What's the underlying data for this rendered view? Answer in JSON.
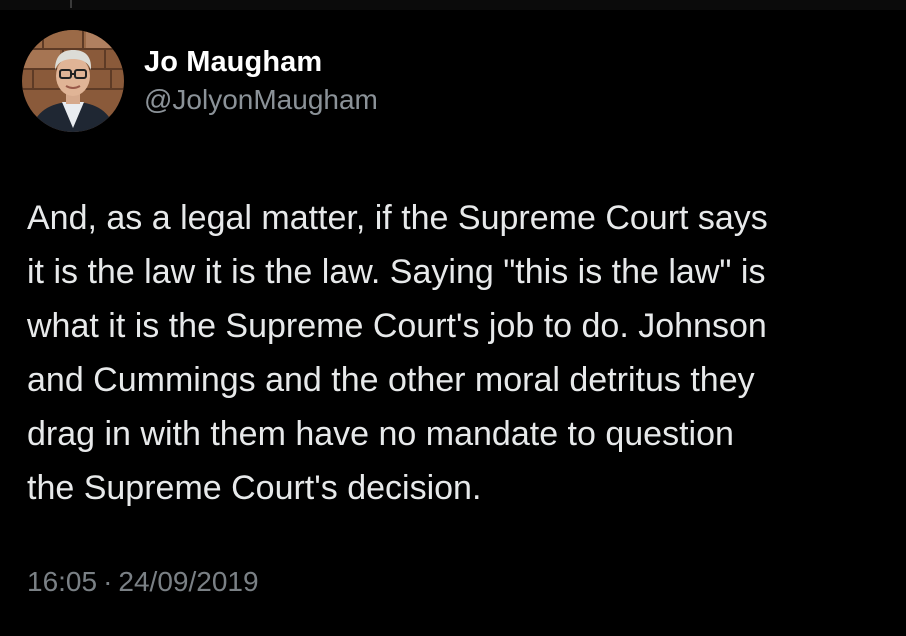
{
  "author": {
    "display_name": "Jo Maugham",
    "handle": "@JolyonMaugham",
    "avatar": "profile-photo"
  },
  "tweet": {
    "text": "And, as a legal matter, if the Supreme Court says\nit is the law it is the law. Saying \"this is the law\" is\nwhat it is the Supreme Court's job to do. Johnson\nand Cummings and the other moral detritus they\ndrag in with them have no mandate to question\nthe Supreme Court's decision."
  },
  "meta": {
    "time": "16:05",
    "separator": "·",
    "date": "24/09/2019"
  },
  "colors": {
    "background": "#000000",
    "name": "#ffffff",
    "body_text": "#e7e9ea",
    "muted": "#7a8085"
  }
}
